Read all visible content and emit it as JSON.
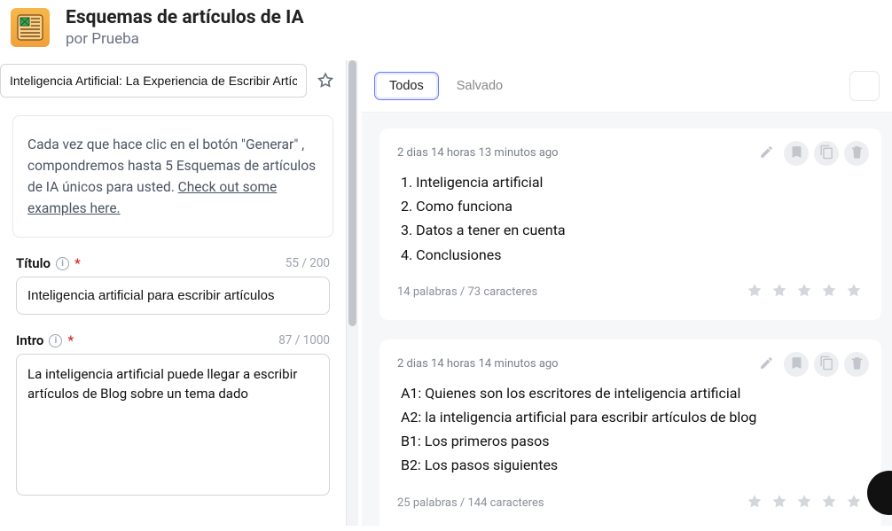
{
  "header": {
    "title": "Esquemas de artículos de IA",
    "by_prefix": "por ",
    "author": "Prueba"
  },
  "search": {
    "value": "Inteligencia Artificial: La Experiencia de Escribir Artíc"
  },
  "info": {
    "text_before_link": "Cada vez que hace clic en el botón \"Generar\" , compondremos hasta 5 Esquemas de artículos de IA únicos para usted. ",
    "link_text": "Check out some examples here."
  },
  "form": {
    "title": {
      "label": "Título",
      "counter": "55 / 200",
      "value": "Inteligencia artificial para escribir artículos"
    },
    "intro": {
      "label": "Intro",
      "counter": "87 / 1000",
      "value": "La inteligencia artificial puede llegar a escribir artículos de Blog sobre un tema dado"
    }
  },
  "tabs": {
    "all": "Todos",
    "saved": "Salvado"
  },
  "cards": [
    {
      "time": "2 dias 14 horas 13 minutos ago",
      "lines": [
        "1. Inteligencia artificial",
        "2. Como funciona",
        "3. Datos a tener en cuenta",
        "4. Conclusiones"
      ],
      "stats": "14 palabras / 73 caracteres"
    },
    {
      "time": "2 dias 14 horas 14 minutos ago",
      "lines": [
        "A1: Quienes son los escritores de inteligencia artificial",
        "A2: la inteligencia artificial para escribir artículos de blog",
        "B1: Los primeros pasos",
        "B2: Los pasos siguientes"
      ],
      "stats": "25 palabras / 144 caracteres"
    }
  ]
}
